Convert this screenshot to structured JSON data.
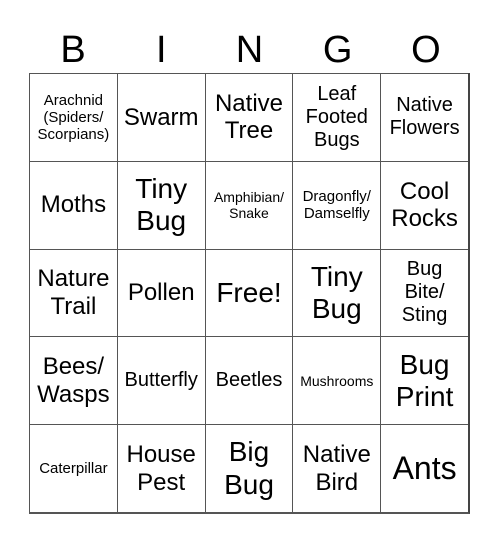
{
  "header": [
    "B",
    "I",
    "N",
    "G",
    "O"
  ],
  "cells": [
    [
      {
        "text": "Arachnid\n(Spiders/\nScorpians)",
        "size": "s-sm"
      },
      {
        "text": "Swarm",
        "size": "s-lg"
      },
      {
        "text": "Native\nTree",
        "size": "s-lg"
      },
      {
        "text": "Leaf\nFooted\nBugs",
        "size": "s-md"
      },
      {
        "text": "Native\nFlowers",
        "size": "s-md"
      }
    ],
    [
      {
        "text": "Moths",
        "size": "s-lg"
      },
      {
        "text": "Tiny\nBug",
        "size": "s-xl"
      },
      {
        "text": "Amphibian/\nSnake",
        "size": "s-xs"
      },
      {
        "text": "Dragonfly/\nDamselfly",
        "size": "s-sm"
      },
      {
        "text": "Cool\nRocks",
        "size": "s-lg"
      }
    ],
    [
      {
        "text": "Nature\nTrail",
        "size": "s-lg"
      },
      {
        "text": "Pollen",
        "size": "s-lg"
      },
      {
        "text": "Free!",
        "size": "s-xl"
      },
      {
        "text": "Tiny\nBug",
        "size": "s-xl"
      },
      {
        "text": "Bug\nBite/\nSting",
        "size": "s-md"
      }
    ],
    [
      {
        "text": "Bees/\nWasps",
        "size": "s-lg"
      },
      {
        "text": "Butterfly",
        "size": "s-md"
      },
      {
        "text": "Beetles",
        "size": "s-md"
      },
      {
        "text": "Mushrooms",
        "size": "s-xs"
      },
      {
        "text": "Bug\nPrint",
        "size": "s-xl"
      }
    ],
    [
      {
        "text": "Caterpillar",
        "size": "s-sm"
      },
      {
        "text": "House\nPest",
        "size": "s-lg"
      },
      {
        "text": "Big\nBug",
        "size": "s-xl"
      },
      {
        "text": "Native\nBird",
        "size": "s-lg"
      },
      {
        "text": "Ants",
        "size": "s-xxl"
      }
    ]
  ]
}
